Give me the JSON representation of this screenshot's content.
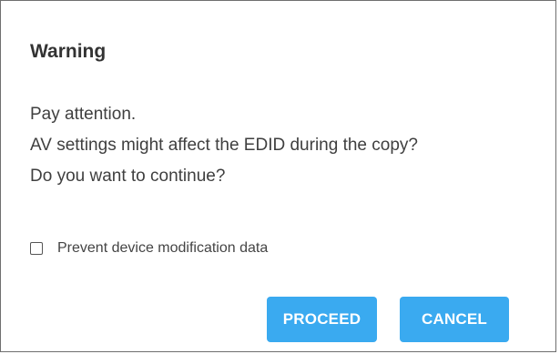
{
  "dialog": {
    "title": "Warning",
    "message_lines": [
      "Pay attention.",
      "AV settings might affect the EDID during the copy?",
      "Do you want to continue?"
    ],
    "checkbox": {
      "label": "Prevent device modification data",
      "checked": false
    },
    "buttons": {
      "proceed_label": "PROCEED",
      "cancel_label": "CANCEL"
    }
  },
  "colors": {
    "button_background": "#3aaaf0",
    "button_text": "#ffffff",
    "border": "#6f6f6f"
  }
}
